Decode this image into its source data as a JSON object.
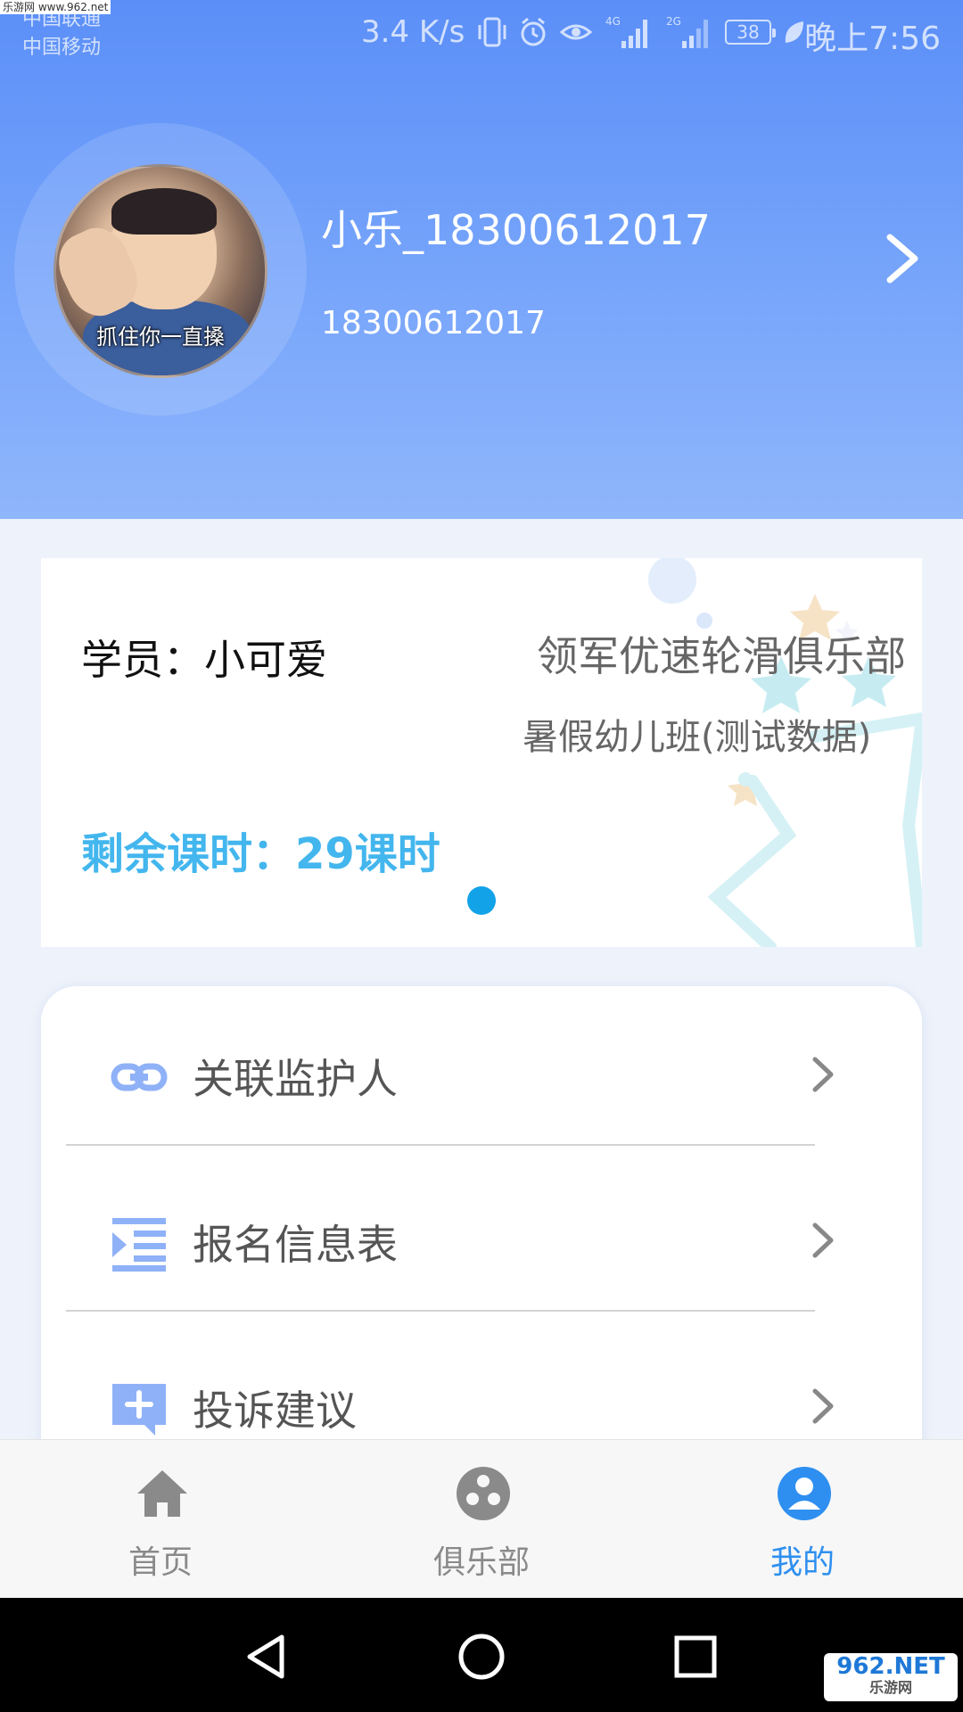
{
  "status_bar": {
    "carrier_1": "中国联通",
    "carrier_2": "中国移动",
    "watermark": "乐游网 www.962.net",
    "net_speed": "3.4 K/s",
    "signal_1": "4G",
    "signal_2": "2G",
    "battery": "38",
    "time": "晚上7:56"
  },
  "profile": {
    "avatar_caption": "抓住你一直搡",
    "name": "小乐_18300612017",
    "phone": "18300612017"
  },
  "student_card": {
    "student_label": "学员：小可爱",
    "club_name": "领军优速轮滑俱乐部",
    "class_name": "暑假幼儿班(测试数据)",
    "remaining_hours": "剩余课时：29课时"
  },
  "menu": {
    "items": [
      {
        "label": "关联监护人",
        "icon": "link-icon"
      },
      {
        "label": "报名信息表",
        "icon": "list-indent-icon"
      },
      {
        "label": "投诉建议",
        "icon": "feedback-add-icon"
      }
    ]
  },
  "tab_bar": {
    "tabs": [
      {
        "label": "首页",
        "icon": "home-icon",
        "active": false
      },
      {
        "label": "俱乐部",
        "icon": "club-icon",
        "active": false
      },
      {
        "label": "我的",
        "icon": "user-icon",
        "active": true
      }
    ]
  },
  "colors": {
    "header_top": "#5b8ff8",
    "header_bottom": "#8fb6fb",
    "accent_text": "#43b6ee",
    "active_tab": "#2e8ff0",
    "page_dot": "#12a2e8"
  },
  "nav_bar": {
    "back_icon": "triangle-back-icon",
    "home_icon": "circle-home-icon",
    "recent_icon": "square-recent-icon"
  },
  "watermark_bottom": {
    "top": "962.NET",
    "bottom": "乐游网"
  }
}
